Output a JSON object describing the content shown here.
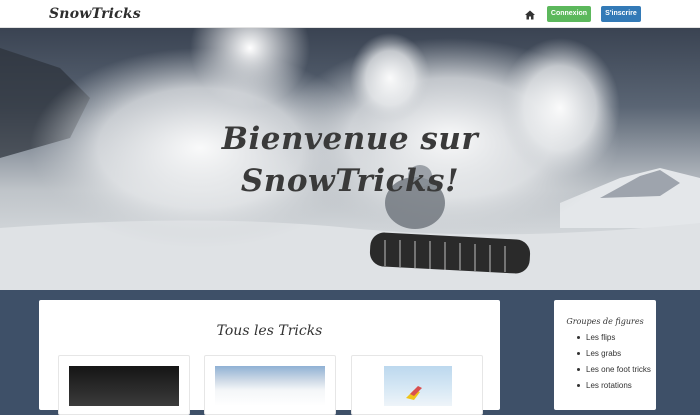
{
  "navbar": {
    "brand": "SnowTricks",
    "home_icon": "home-icon",
    "login_label": "Connexion",
    "register_label": "S'inscrire"
  },
  "hero": {
    "title_line1": "Bienvenue sur",
    "title_line2": "SnowTricks!"
  },
  "main": {
    "section_title": "Tous les Tricks"
  },
  "sidebar": {
    "title": "Groupes de figures",
    "items": [
      "Les flips",
      "Les grabs",
      "Les one foot tricks",
      "Les rotations"
    ]
  },
  "colors": {
    "login": "#5cb85c",
    "register": "#337ab7",
    "page_background": "#3e5068"
  }
}
